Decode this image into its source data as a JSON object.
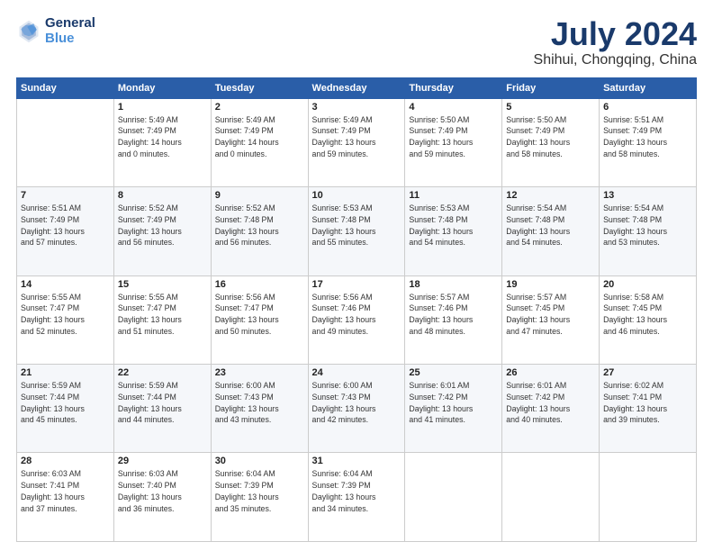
{
  "header": {
    "logo_line1": "General",
    "logo_line2": "Blue",
    "title": "July 2024",
    "subtitle": "Shihui, Chongqing, China"
  },
  "days_of_week": [
    "Sunday",
    "Monday",
    "Tuesday",
    "Wednesday",
    "Thursday",
    "Friday",
    "Saturday"
  ],
  "weeks": [
    [
      {
        "day": "",
        "info": ""
      },
      {
        "day": "1",
        "info": "Sunrise: 5:49 AM\nSunset: 7:49 PM\nDaylight: 14 hours\nand 0 minutes."
      },
      {
        "day": "2",
        "info": "Sunrise: 5:49 AM\nSunset: 7:49 PM\nDaylight: 14 hours\nand 0 minutes."
      },
      {
        "day": "3",
        "info": "Sunrise: 5:49 AM\nSunset: 7:49 PM\nDaylight: 13 hours\nand 59 minutes."
      },
      {
        "day": "4",
        "info": "Sunrise: 5:50 AM\nSunset: 7:49 PM\nDaylight: 13 hours\nand 59 minutes."
      },
      {
        "day": "5",
        "info": "Sunrise: 5:50 AM\nSunset: 7:49 PM\nDaylight: 13 hours\nand 58 minutes."
      },
      {
        "day": "6",
        "info": "Sunrise: 5:51 AM\nSunset: 7:49 PM\nDaylight: 13 hours\nand 58 minutes."
      }
    ],
    [
      {
        "day": "7",
        "info": "Sunrise: 5:51 AM\nSunset: 7:49 PM\nDaylight: 13 hours\nand 57 minutes."
      },
      {
        "day": "8",
        "info": "Sunrise: 5:52 AM\nSunset: 7:49 PM\nDaylight: 13 hours\nand 56 minutes."
      },
      {
        "day": "9",
        "info": "Sunrise: 5:52 AM\nSunset: 7:48 PM\nDaylight: 13 hours\nand 56 minutes."
      },
      {
        "day": "10",
        "info": "Sunrise: 5:53 AM\nSunset: 7:48 PM\nDaylight: 13 hours\nand 55 minutes."
      },
      {
        "day": "11",
        "info": "Sunrise: 5:53 AM\nSunset: 7:48 PM\nDaylight: 13 hours\nand 54 minutes."
      },
      {
        "day": "12",
        "info": "Sunrise: 5:54 AM\nSunset: 7:48 PM\nDaylight: 13 hours\nand 54 minutes."
      },
      {
        "day": "13",
        "info": "Sunrise: 5:54 AM\nSunset: 7:48 PM\nDaylight: 13 hours\nand 53 minutes."
      }
    ],
    [
      {
        "day": "14",
        "info": "Sunrise: 5:55 AM\nSunset: 7:47 PM\nDaylight: 13 hours\nand 52 minutes."
      },
      {
        "day": "15",
        "info": "Sunrise: 5:55 AM\nSunset: 7:47 PM\nDaylight: 13 hours\nand 51 minutes."
      },
      {
        "day": "16",
        "info": "Sunrise: 5:56 AM\nSunset: 7:47 PM\nDaylight: 13 hours\nand 50 minutes."
      },
      {
        "day": "17",
        "info": "Sunrise: 5:56 AM\nSunset: 7:46 PM\nDaylight: 13 hours\nand 49 minutes."
      },
      {
        "day": "18",
        "info": "Sunrise: 5:57 AM\nSunset: 7:46 PM\nDaylight: 13 hours\nand 48 minutes."
      },
      {
        "day": "19",
        "info": "Sunrise: 5:57 AM\nSunset: 7:45 PM\nDaylight: 13 hours\nand 47 minutes."
      },
      {
        "day": "20",
        "info": "Sunrise: 5:58 AM\nSunset: 7:45 PM\nDaylight: 13 hours\nand 46 minutes."
      }
    ],
    [
      {
        "day": "21",
        "info": "Sunrise: 5:59 AM\nSunset: 7:44 PM\nDaylight: 13 hours\nand 45 minutes."
      },
      {
        "day": "22",
        "info": "Sunrise: 5:59 AM\nSunset: 7:44 PM\nDaylight: 13 hours\nand 44 minutes."
      },
      {
        "day": "23",
        "info": "Sunrise: 6:00 AM\nSunset: 7:43 PM\nDaylight: 13 hours\nand 43 minutes."
      },
      {
        "day": "24",
        "info": "Sunrise: 6:00 AM\nSunset: 7:43 PM\nDaylight: 13 hours\nand 42 minutes."
      },
      {
        "day": "25",
        "info": "Sunrise: 6:01 AM\nSunset: 7:42 PM\nDaylight: 13 hours\nand 41 minutes."
      },
      {
        "day": "26",
        "info": "Sunrise: 6:01 AM\nSunset: 7:42 PM\nDaylight: 13 hours\nand 40 minutes."
      },
      {
        "day": "27",
        "info": "Sunrise: 6:02 AM\nSunset: 7:41 PM\nDaylight: 13 hours\nand 39 minutes."
      }
    ],
    [
      {
        "day": "28",
        "info": "Sunrise: 6:03 AM\nSunset: 7:41 PM\nDaylight: 13 hours\nand 37 minutes."
      },
      {
        "day": "29",
        "info": "Sunrise: 6:03 AM\nSunset: 7:40 PM\nDaylight: 13 hours\nand 36 minutes."
      },
      {
        "day": "30",
        "info": "Sunrise: 6:04 AM\nSunset: 7:39 PM\nDaylight: 13 hours\nand 35 minutes."
      },
      {
        "day": "31",
        "info": "Sunrise: 6:04 AM\nSunset: 7:39 PM\nDaylight: 13 hours\nand 34 minutes."
      },
      {
        "day": "",
        "info": ""
      },
      {
        "day": "",
        "info": ""
      },
      {
        "day": "",
        "info": ""
      }
    ]
  ]
}
